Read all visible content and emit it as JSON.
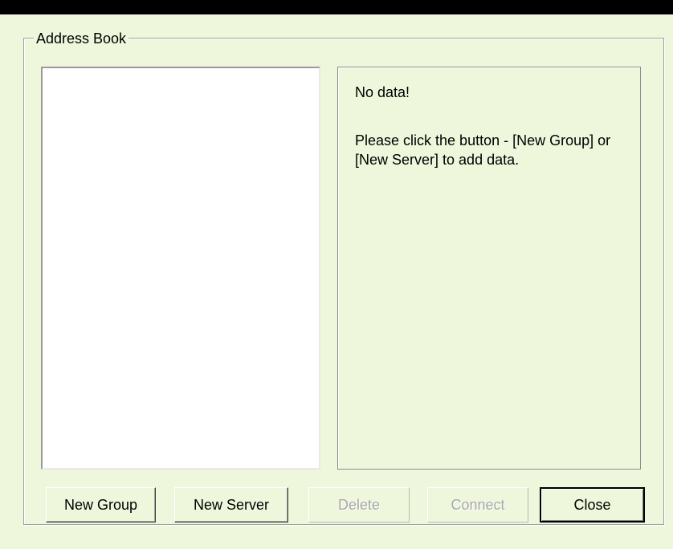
{
  "address_book": {
    "title": "Address Book",
    "detail": {
      "no_data": "No data!",
      "instruction": "Please click the button - [New Group] or [New Server] to add data."
    },
    "buttons": {
      "new_group": "New Group",
      "new_server": "New Server",
      "delete": "Delete",
      "connect": "Connect",
      "close": "Close"
    }
  },
  "colors": {
    "background": "#eef7dc",
    "list_background": "#ffffff",
    "disabled_text": "#a8a8a8",
    "top_bar": "#000000"
  }
}
